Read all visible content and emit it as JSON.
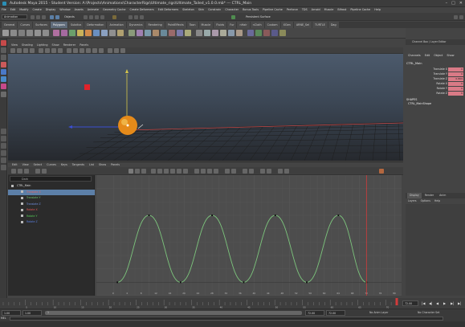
{
  "window": {
    "title": "Autodesk Maya 2015 - Student Version: A:\\Projects\\Animations\\CharacterRigs\\Ultimate_rigs\\Ultimate_Tailed_v1.0.0.mb*   ---   CTRL_Main",
    "controls": [
      "–",
      "□",
      "✕"
    ]
  },
  "menubar": [
    "File",
    "Edit",
    "Modify",
    "Create",
    "Display",
    "Window",
    "Assets",
    "Animate",
    "Geometry Cache",
    "Create Deformers",
    "Edit Deformers",
    "Skeleton",
    "Skin",
    "Constrain",
    "Character",
    "Bonus Tools",
    "Pipeline Cache",
    "Perforce",
    "TDS",
    "Arnold",
    "Muscle",
    "Bifrost",
    "Pipeline Cache",
    "Help"
  ],
  "statusline": {
    "menuset": "Animation",
    "object_label": "Objects",
    "render_label": "Persistent Surface"
  },
  "shelf_tabs": [
    {
      "label": "General",
      "active": false
    },
    {
      "label": "Curves",
      "active": false
    },
    {
      "label": "Surfaces",
      "active": false
    },
    {
      "label": "Polygons",
      "active": true
    },
    {
      "label": "Subdivs",
      "active": false
    },
    {
      "label": "Deformation",
      "active": false
    },
    {
      "label": "Animation",
      "active": false
    },
    {
      "label": "Dynamics",
      "active": false
    },
    {
      "label": "Rendering",
      "active": false
    },
    {
      "label": "PaintEffects",
      "active": false
    },
    {
      "label": "Toon",
      "active": false
    },
    {
      "label": "Muscle",
      "active": false
    },
    {
      "label": "Fluids",
      "active": false
    },
    {
      "label": "Fur",
      "active": false
    },
    {
      "label": "nHair",
      "active": false
    },
    {
      "label": "nCloth",
      "active": false
    },
    {
      "label": "Custom",
      "active": false
    },
    {
      "label": "XGen",
      "active": false
    },
    {
      "label": "ARNE_Sel",
      "active": false
    },
    {
      "label": "TURTLE",
      "active": false
    },
    {
      "label": "Dag",
      "active": false
    }
  ],
  "viewport": {
    "menu": [
      "View",
      "Shading",
      "Lighting",
      "Show",
      "Renderer",
      "Panels"
    ]
  },
  "graph_editor": {
    "menu": [
      "Edit",
      "View",
      "Select",
      "Curves",
      "Keys",
      "Tangents",
      "List",
      "Show",
      "Panels"
    ],
    "search_text": "Dark",
    "outliner": [
      {
        "label": "CTRL_Main",
        "color": "#dddddd",
        "selected": false,
        "indent": 0
      },
      {
        "label": "Translate X",
        "color": "#e06666",
        "selected": true,
        "indent": 2
      },
      {
        "label": "Translate Y",
        "color": "#6ec36e",
        "selected": false,
        "indent": 2
      },
      {
        "label": "Translate Z",
        "color": "#6f8fe0",
        "selected": false,
        "indent": 2
      },
      {
        "label": "Rotate X",
        "color": "#e05555",
        "selected": false,
        "indent": 2
      },
      {
        "label": "Rotate Y",
        "color": "#55cc55",
        "selected": false,
        "indent": 2
      },
      {
        "label": "Rotate Z",
        "color": "#5a7fe0",
        "selected": false,
        "indent": 2
      }
    ],
    "curve_color": "#7cc47c",
    "curve_keys": [
      {
        "frame": 1,
        "value": 0
      },
      {
        "frame": 10,
        "value": 10
      },
      {
        "frame": 19,
        "value": 0
      },
      {
        "frame": 28,
        "value": 10
      },
      {
        "frame": 37,
        "value": 0
      },
      {
        "frame": 46,
        "value": 10
      },
      {
        "frame": 55,
        "value": 0
      },
      {
        "frame": 64,
        "value": 10
      },
      {
        "frame": 72,
        "value": 0
      }
    ],
    "current_frame": 72
  },
  "channel_box": {
    "title": "Channel Box / Layer Editor",
    "menu": [
      "Channels",
      "Edit",
      "Object",
      "Show"
    ],
    "object": "CTRL_Main",
    "attributes": [
      {
        "name": "Translate X",
        "value": "0"
      },
      {
        "name": "Translate Y",
        "value": "0"
      },
      {
        "name": "Translate Z",
        "value": "0.869"
      },
      {
        "name": "Rotate X",
        "value": "0"
      },
      {
        "name": "Rotate Y",
        "value": "0"
      },
      {
        "name": "Rotate Z",
        "value": "0"
      }
    ],
    "shapes_header": "SHAPES",
    "shape_name": "CTRL_MainShape",
    "value_color": "#d97a86"
  },
  "layer_editor": {
    "tabs": [
      {
        "label": "Display",
        "active": true
      },
      {
        "label": "Render",
        "active": false
      },
      {
        "label": "Anim",
        "active": false
      }
    ],
    "menu": [
      "Layers",
      "Options",
      "Help"
    ]
  },
  "time_slider": {
    "start": 1,
    "end": 72,
    "current_frame": 72,
    "current_frame_field": "72.00",
    "playback_buttons": [
      "|◀",
      "◀|",
      "◀",
      "▶",
      "▶|",
      "▶|"
    ]
  },
  "range_slider": {
    "start_field": "1.00",
    "range_start_field": "1.00",
    "range_end_field": "72.00",
    "end_field": "72.00",
    "bar_label": "1",
    "anim_layer": "No Anim Layer",
    "char_set": "No Character Set"
  },
  "command_line": {
    "mel_label": "MEL"
  }
}
